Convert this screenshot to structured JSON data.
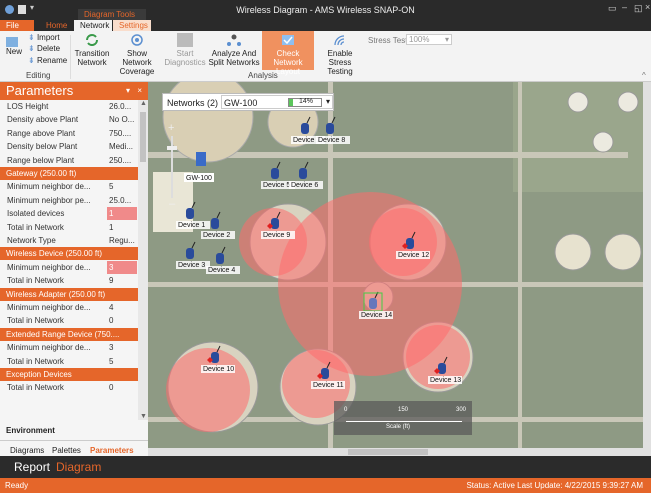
{
  "window": {
    "title": "Wireless Diagram - AMS Wireless SNAP-ON"
  },
  "tabs": {
    "file": "File",
    "home": "Home",
    "diagram_tools": "Diagram Tools",
    "network": "Network",
    "settings": "Settings"
  },
  "ribbon": {
    "import": "Import",
    "new": "New",
    "delete": "Delete",
    "rename": "Rename",
    "editing": "Editing",
    "transition_network": [
      "Transition",
      "Network"
    ],
    "show_network_coverage": [
      "Show Network",
      "Coverage"
    ],
    "start_diagnostics": [
      "Start",
      "Diagnostics"
    ],
    "analyze_split": [
      "Analyze And",
      "Split Networks"
    ],
    "check_layout": [
      "Check Network",
      "Layout"
    ],
    "enable_stress": [
      "Enable Stress",
      "Testing"
    ],
    "stress_test_label": "Stress Test",
    "stress_test_value": "100%",
    "analysis": "Analysis"
  },
  "parameters": {
    "title": "Parameters",
    "rows_top": [
      {
        "k": "LOS Height",
        "v": "26.0..."
      },
      {
        "k": "Density above Plant",
        "v": "No O..."
      },
      {
        "k": "Range above Plant",
        "v": "750...."
      },
      {
        "k": "Density below Plant",
        "v": "Medi..."
      },
      {
        "k": "Range below Plant",
        "v": "250...."
      }
    ],
    "sections": [
      {
        "title": "Gateway (250.00 ft)",
        "rows": [
          {
            "k": "Minimum neighbor de...",
            "v": "5"
          },
          {
            "k": "Minimum neighbor pe...",
            "v": "25.0..."
          },
          {
            "k": "Isolated devices",
            "v": "1",
            "hl": true
          },
          {
            "k": "Total in Network",
            "v": "1"
          },
          {
            "k": "Network Type",
            "v": "Regu..."
          }
        ]
      },
      {
        "title": "Wireless Device (250.00 ft)",
        "rows": [
          {
            "k": "Minimum neighbor de...",
            "v": "3",
            "hl": true
          },
          {
            "k": "Total in Network",
            "v": "9"
          }
        ]
      },
      {
        "title": "Wireless Adapter (250.00 ft)",
        "rows": [
          {
            "k": "Minimum neighbor de...",
            "v": "4"
          },
          {
            "k": "Total in Network",
            "v": "0"
          }
        ]
      },
      {
        "title": "Extended Range Device (750....",
        "rows": [
          {
            "k": "Minimum neighbor de...",
            "v": "3"
          },
          {
            "k": "Total in Network",
            "v": "5"
          }
        ]
      },
      {
        "title": "Exception Devices",
        "rows": [
          {
            "k": "Total in Network",
            "v": "0"
          }
        ]
      }
    ]
  },
  "environment": "Environment",
  "bottom_tabs": {
    "diagrams": "Diagrams",
    "palettes": "Palettes",
    "parameters": "Parameters"
  },
  "views": {
    "report": "Report",
    "diagram": "Diagram"
  },
  "map": {
    "networks_label": "Networks (2)",
    "network_selected": "GW-100",
    "progress_text": "14%",
    "progress": 0.14,
    "scale_ticks": [
      "0",
      "150",
      "300"
    ],
    "scale_label": "Scale (ft)",
    "gateway": "GW-100",
    "devices": [
      "Device 1",
      "Device 2",
      "Device 3",
      "Device 4",
      "Device 5",
      "Device 6",
      "Device 7",
      "Device 8",
      "Device 9",
      "Device 10",
      "Device 11",
      "Device 12",
      "Device 13",
      "Device 14"
    ]
  },
  "status": {
    "left": "Ready",
    "right": "Status: Active  Last Update: 4/22/2015 9:39:27 AM"
  },
  "colors": {
    "accent": "#e5662a",
    "coverage": "#ff6b6b"
  }
}
